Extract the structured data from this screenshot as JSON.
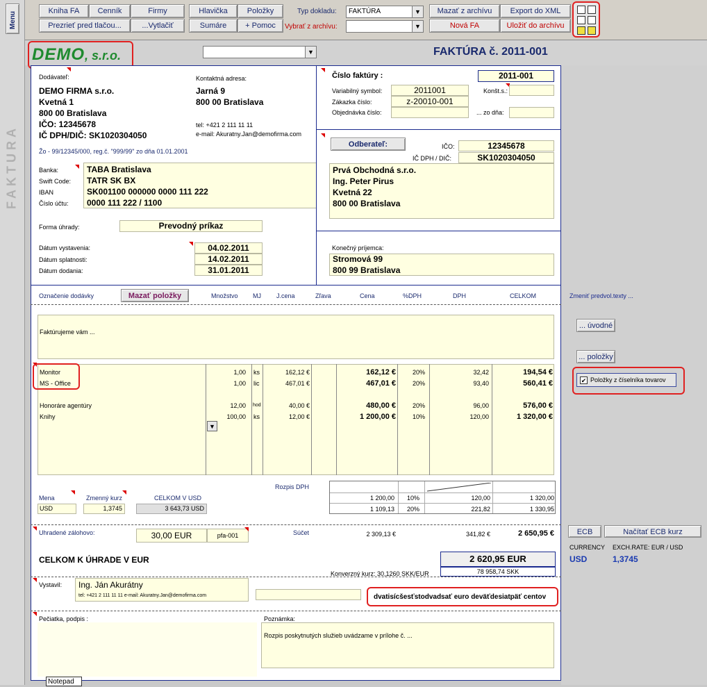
{
  "toolbar": {
    "menu": "Menu",
    "row1": [
      "Kniha FA",
      "Cenník",
      "Firmy",
      "Hlavička",
      "Položky"
    ],
    "row2": [
      "Prezrieť pred tlačou...",
      "...Vytlačiť",
      "Sumáre",
      "+ Pomoc"
    ],
    "typ_label": "Typ dokladu:",
    "typ_value": "FAKTÚRA",
    "vybrat_label": "Vybrať z archívu:",
    "right": [
      "Mazať z archívu",
      "Export do XML",
      "Nová FA",
      "Uložiť do archívu"
    ]
  },
  "header": {
    "logo": "DEMO",
    "logo_suffix": ", s.r.o.",
    "title": "FAKTÚRA č. 2011-001",
    "side_vertical": "FAKTURA"
  },
  "supplier": {
    "label": "Dodávateľ:",
    "lines": [
      "DEMO FIRMA s.r.o.",
      "Kvetná 1",
      "800 00 Bratislava",
      "IČO: 12345678",
      "IČ DPH/DIČ: SK1020304050"
    ],
    "contact_label": "Kontaktná adresa:",
    "contact_lines": [
      "Jarná 9",
      "800 00 Bratislava"
    ],
    "tel": "tel:   +421 2 111 11 11",
    "email": "e-mail: Akuratny.Jan@demofirma.com",
    "register": "Žo - 99/12345/000, reg.č. \"999/99\" zo dňa 01.01.2001"
  },
  "bank": {
    "labels": [
      "Banka:",
      "Swift Code:",
      "IBAN",
      "Číslo účtu:"
    ],
    "values": [
      "TABA Bratislava",
      "TATR SK BX",
      "SK001100 000000 0000 111 222",
      "0000 111 222 / 1100"
    ]
  },
  "payment": {
    "label": "Forma úhrady:",
    "value": "Prevodný príkaz"
  },
  "dates": {
    "labels": [
      "Dátum vystavenia:",
      "Dátum splatnosti:",
      "Dátum dodania:"
    ],
    "values": [
      "04.02.2011",
      "14.02.2011",
      "31.01.2011"
    ]
  },
  "invoice": {
    "cislo_label": "Číslo faktúry :",
    "cislo": "2011-001",
    "vs_label": "Variabilný symbol:",
    "vs": "2011001",
    "ks_label": "Konšt.s.:",
    "zakazka_label": "Zákazka číslo:",
    "zakazka": "z-20010-001",
    "objednavka_label": "Objednávka číslo:",
    "zo_dna": "... zo dňa:"
  },
  "customer": {
    "button": "Odberateľ:",
    "ico_label": "IČO:",
    "ico": "12345678",
    "dic_label": "IČ DPH / DIČ:",
    "dic": "SK1020304050",
    "lines": [
      "Prvá Obchodná s.r.o.",
      "Ing. Peter Pirus",
      "Kvetná 22",
      "800 00 Bratislava"
    ],
    "final_label": "Konečný príjemca:",
    "final_lines": [
      "Stromová 99",
      "800 99 Bratislava"
    ]
  },
  "columns": {
    "oznacenie": "Označenie dodávky",
    "mazat": "Mazať položky",
    "headers": [
      "Množstvo",
      "MJ",
      "J.cena",
      "Zľava",
      "Cena",
      "%DPH",
      "DPH",
      "CELKOM"
    ],
    "zmenit": "Zmeniť predvol.texty ..."
  },
  "intro_text": "Faktúrujeme vám ...",
  "items": [
    {
      "name": "Monitor",
      "qty": "1,00",
      "mj": "ks",
      "unit": "162,12 €",
      "price": "162,12 €",
      "vat": "20%",
      "dph": "32,42",
      "total": "194,54 €"
    },
    {
      "name": "MS - Office",
      "qty": "1,00",
      "mj": "lic",
      "unit": "467,01 €",
      "price": "467,01 €",
      "vat": "20%",
      "dph": "93,40",
      "total": "560,41 €"
    },
    {
      "name": "Honoráre agentúry",
      "qty": "12,00",
      "mj": "hod",
      "unit": "40,00 €",
      "price": "480,00 €",
      "vat": "20%",
      "dph": "96,00",
      "total": "576,00 €"
    },
    {
      "name": "Knihy",
      "qty": "100,00",
      "mj": "ks",
      "unit": "12,00 €",
      "price": "1 200,00 €",
      "vat": "10%",
      "dph": "120,00",
      "total": "1 320,00 €"
    }
  ],
  "side_buttons": {
    "uvodne": "... úvodné",
    "polozky": "... položky",
    "ciselnik": "Položky z číselníka tovarov"
  },
  "currency": {
    "mena_label": "Mena",
    "mena": "USD",
    "kurz_label": "Zmenný kurz",
    "kurz": "1,3745",
    "celkom_label": "CELKOM V USD",
    "celkom": "3 643,73 USD"
  },
  "vat_summary": {
    "label": "Rozpis DPH",
    "rows": [
      {
        "base": "1 200,00",
        "rate": "10%",
        "dph": "120,00",
        "total": "1 320,00"
      },
      {
        "base": "1 109,13",
        "rate": "20%",
        "dph": "221,82",
        "total": "1 330,95"
      }
    ]
  },
  "deposit": {
    "label": "Uhradené zálohovo:",
    "value": "30,00 EUR",
    "ref": "pfa-001"
  },
  "sum": {
    "label": "Súčet",
    "base": "2 309,13 €",
    "dph": "341,82 €",
    "total": "2 650,95 €"
  },
  "total_due": {
    "label": "CELKOM K ÚHRADE V EUR",
    "value": "2 620,95 EUR",
    "conv_label": "Konverzný kurz: 30,1260 SKK/EUR",
    "skk": "78 958,74 SKK"
  },
  "ecb": {
    "button": "ECB",
    "load": "Načítať ECB kurz",
    "currency_label": "CURRENCY",
    "rate_label": "EXCH.RATE: EUR / USD",
    "currency": "USD",
    "rate": "1,3745"
  },
  "issuer": {
    "label": "Vystavil:",
    "name": "Ing. Ján Akurátny",
    "contact": "tel: +421 2 111 11 11  e-mail: Akuratny.Jan@demofirma.com"
  },
  "words": "dvatisícšesťstodvadsať euro deväťdesiatpäť centov",
  "stamp_label": "Pečiatka, podpis :",
  "note_label": "Poznámka:",
  "note": "Rozpis poskytnutých služieb uvádzame v prílohe č. ...",
  "notepad": "Notepad"
}
